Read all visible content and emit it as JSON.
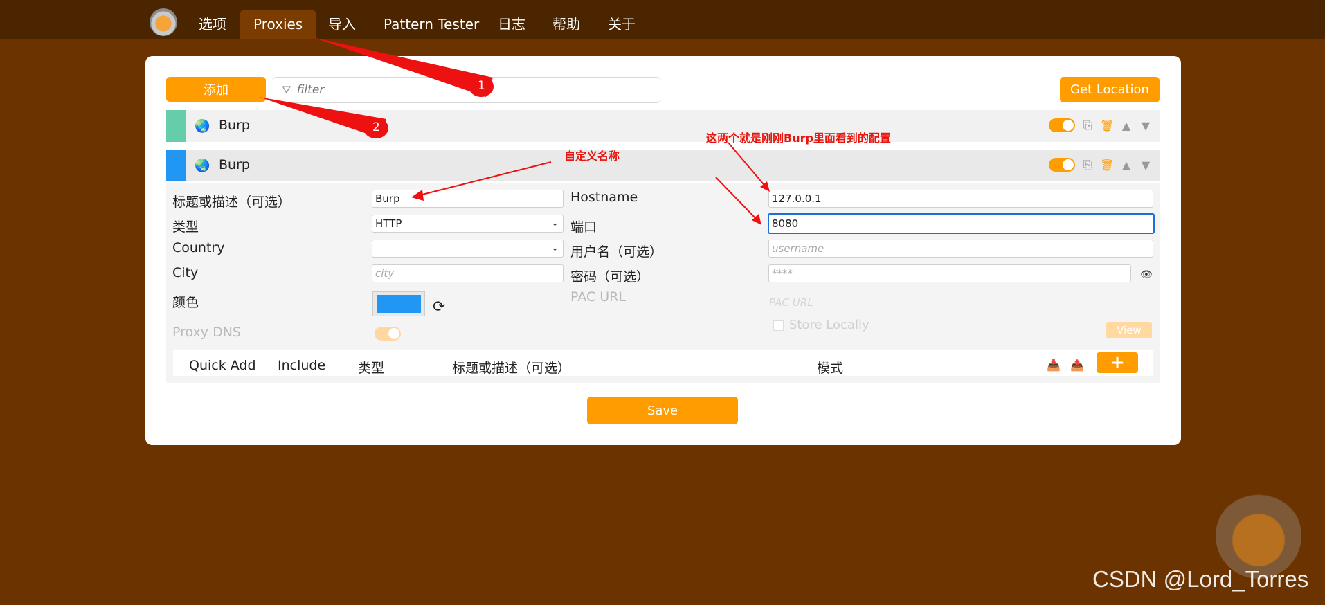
{
  "nav": {
    "tabs": [
      "选项",
      "Proxies",
      "导入",
      "Pattern Tester",
      "日志",
      "帮助",
      "关于"
    ],
    "active": "Proxies"
  },
  "toolbar": {
    "add_label": "添加",
    "filter_placeholder": "filter",
    "get_location_label": "Get Location"
  },
  "proxies": [
    {
      "name": "Burp",
      "color": "#66cdaa",
      "enabled": true
    },
    {
      "name": "Burp",
      "color": "#2196f3",
      "enabled": true
    }
  ],
  "detail": {
    "title_label": "标题或描述（可选）",
    "title_value": "Burp",
    "type_label": "类型",
    "type_value": "HTTP",
    "country_label": "Country",
    "country_value": "",
    "city_label": "City",
    "city_placeholder": "city",
    "color_label": "颜色",
    "color_value": "#2196f3",
    "proxy_dns_label": "Proxy DNS",
    "hostname_label": "Hostname",
    "hostname_value": "127.0.0.1",
    "port_label": "端口",
    "port_value": "8080",
    "username_label": "用户名（可选）",
    "username_placeholder": "username",
    "password_label": "密码（可选）",
    "password_placeholder": "****",
    "pac_url_label": "PAC URL",
    "pac_url_placeholder": "PAC URL",
    "store_locally_label": "Store Locally",
    "view_label": "View"
  },
  "patterns": {
    "headers": [
      "Quick Add",
      "Include",
      "类型",
      "标题或描述（可选）",
      "模式"
    ],
    "add_symbol": "+"
  },
  "save_label": "Save",
  "annotations": {
    "badge1": "1",
    "badge2": "2",
    "custom_name": "自定义名称",
    "burp_config": "这两个就是刚刚Burp里面看到的配置"
  },
  "watermark": "CSDN @Lord_Torres"
}
